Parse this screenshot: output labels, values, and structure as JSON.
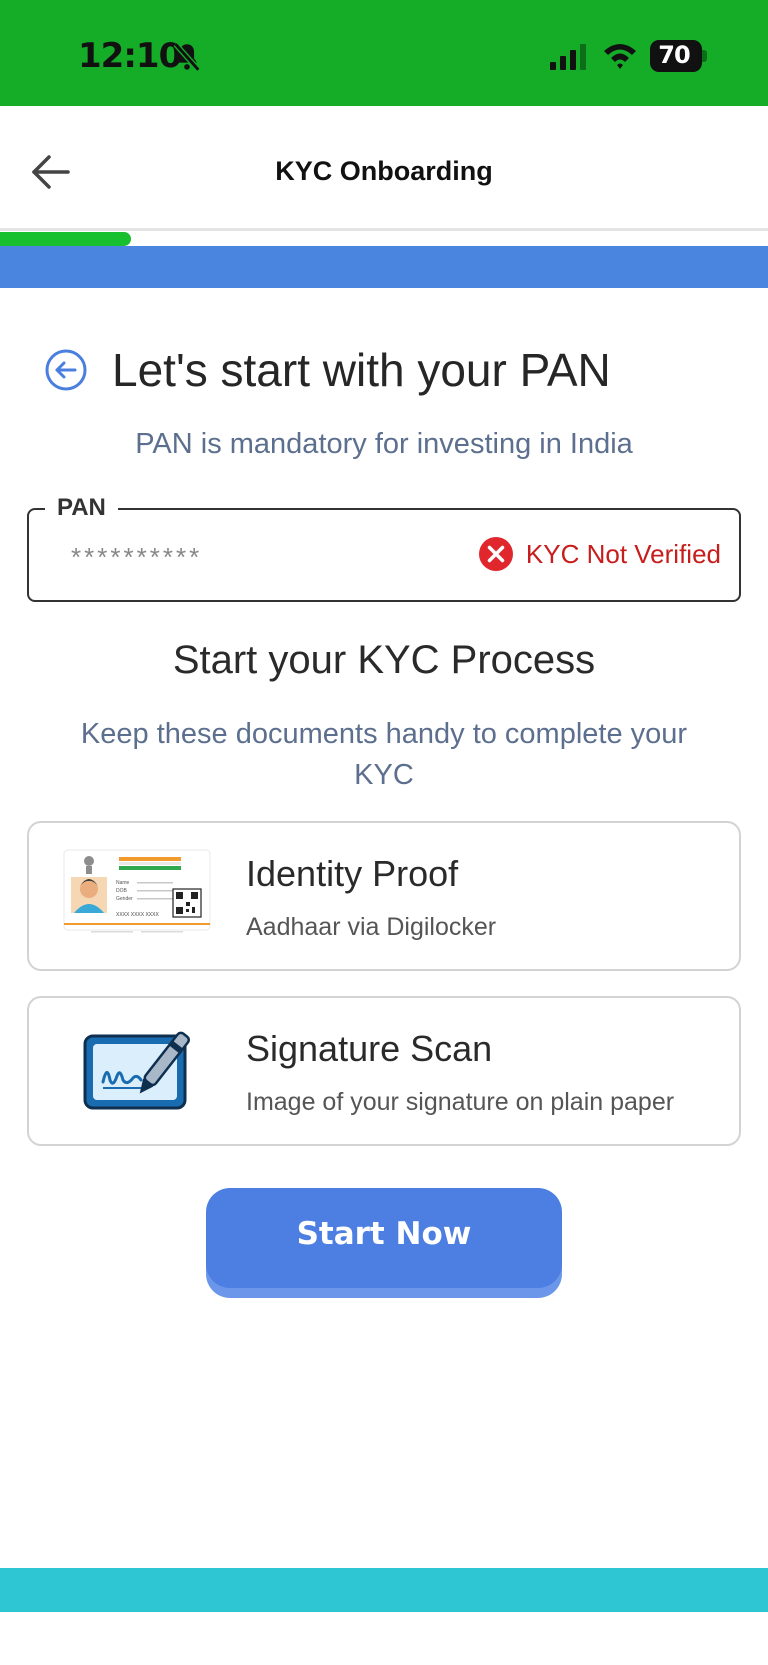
{
  "status_bar": {
    "time": "12:10",
    "battery_level": "70",
    "icons": [
      "bell-muted-icon",
      "cellular-signal-icon",
      "wifi-icon",
      "battery-icon"
    ]
  },
  "header": {
    "title": "KYC Onboarding",
    "back_icon": "arrow-left-icon",
    "progress_fraction": 0.17
  },
  "main": {
    "title": "Let's start with your PAN",
    "subtitle": "PAN is mandatory for investing in India",
    "pan_field": {
      "label": "PAN",
      "value": "**********",
      "status_text": "KYC Not Verified",
      "status_icon": "error-x-icon"
    },
    "section_title": "Start your KYC Process",
    "section_desc": "Keep these documents handy to complete your KYC",
    "documents": [
      {
        "title": "Identity Proof",
        "subtitle": "Aadhaar via Digilocker",
        "icon": "aadhaar-card-icon"
      },
      {
        "title": "Signature Scan",
        "subtitle": "Image of your signature on plain paper",
        "icon": "signature-pen-icon"
      }
    ],
    "cta_label": "Start Now"
  },
  "colors": {
    "status_bar": "#15ad28",
    "progress": "#18bf2e",
    "blue_band": "#4a86e0",
    "cta": "#4d7ee2",
    "error": "#c81d1d",
    "footer_band": "#2ec6d3"
  }
}
